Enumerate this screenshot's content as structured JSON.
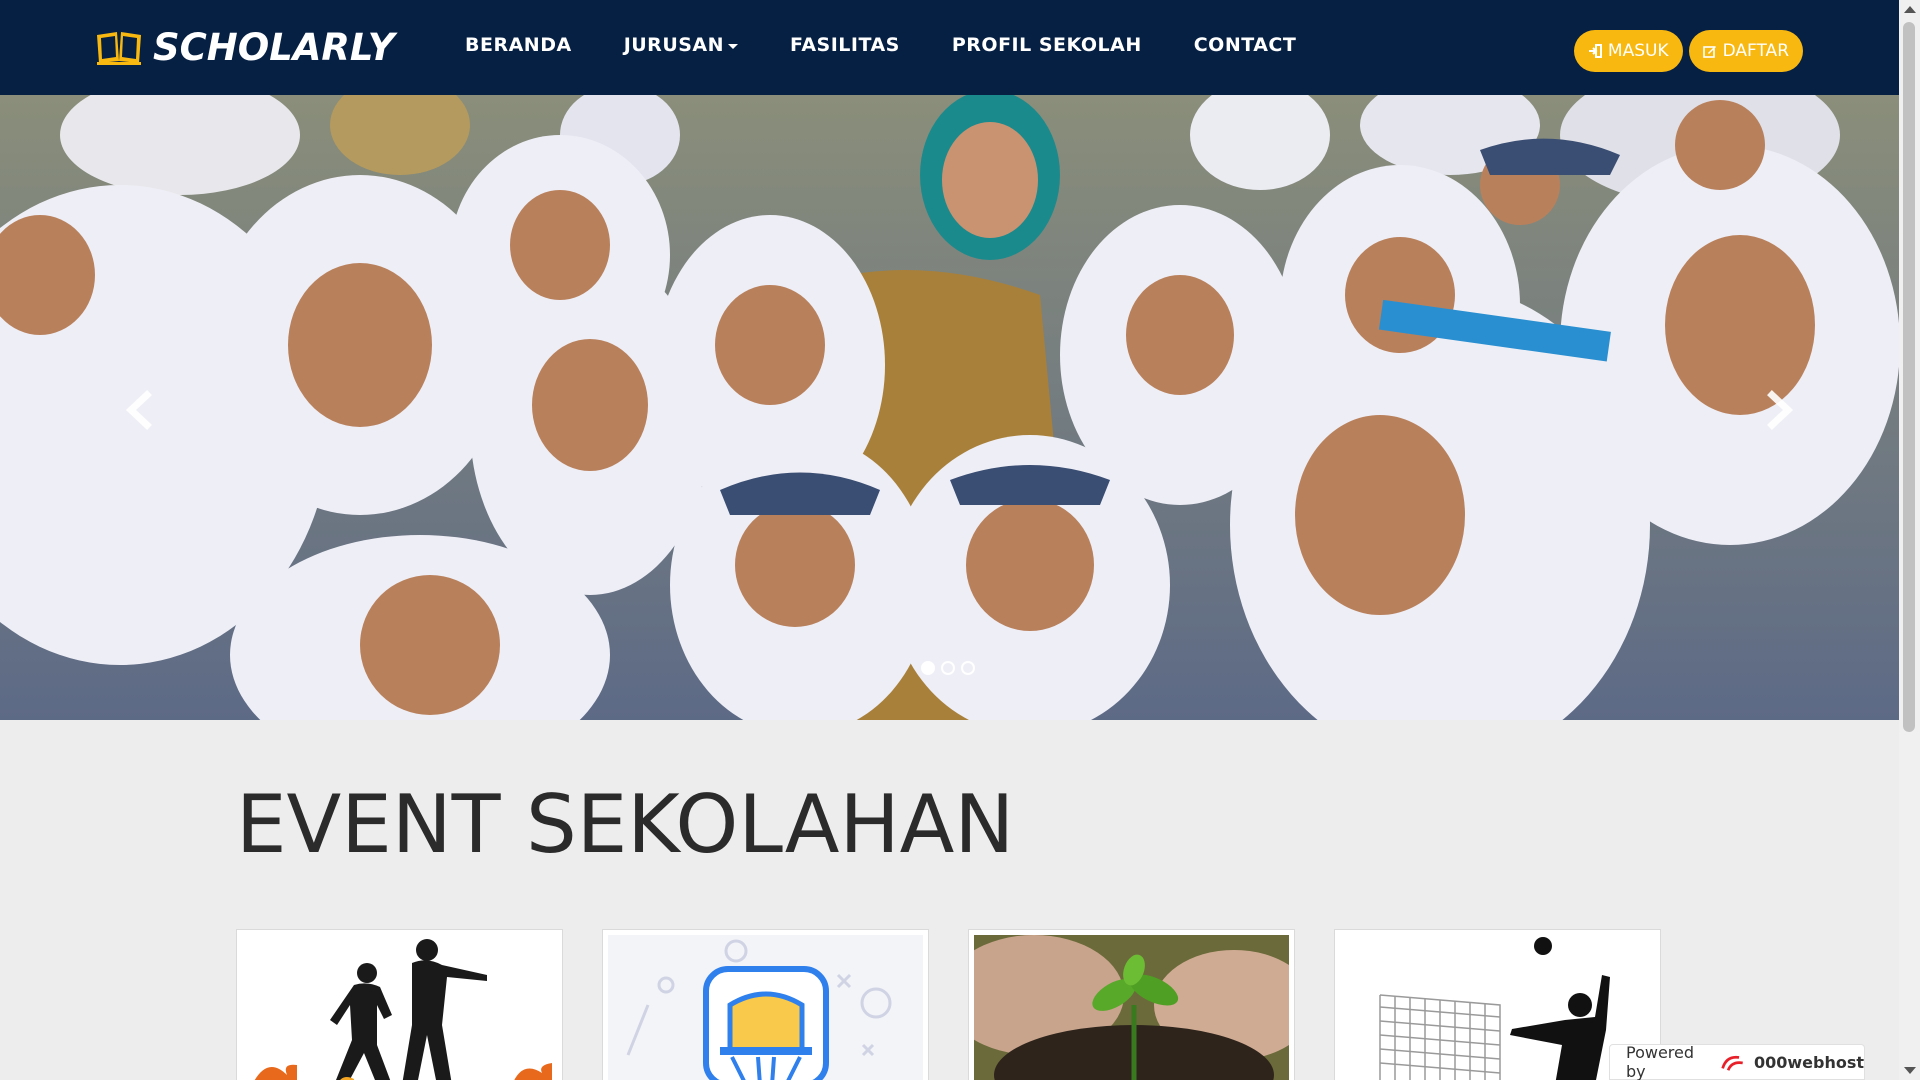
{
  "brand": {
    "name": "SCHOLARLY"
  },
  "nav": {
    "items": [
      {
        "label": "BERANDA"
      },
      {
        "label": "JURUSAN",
        "has_dropdown": true
      },
      {
        "label": "FASILITAS"
      },
      {
        "label": "PROFIL SEKOLAH"
      },
      {
        "label": "CONTACT"
      }
    ],
    "login_label": "MASUK",
    "register_label": "DAFTAR"
  },
  "carousel": {
    "slide_count": 3,
    "active_index": 0
  },
  "section": {
    "title": "EVENT SEKOLAHAN"
  },
  "powered_by": {
    "label": "Powered by",
    "host": "000webhost"
  },
  "colors": {
    "navbar": "#062044",
    "accent": "#f8b810",
    "page_bg": "#ededed"
  }
}
